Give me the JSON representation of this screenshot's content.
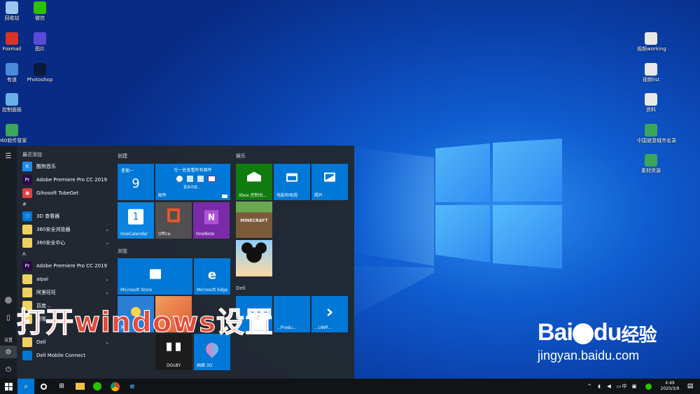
{
  "desktop": {
    "icons_left": [
      {
        "label": "回收站",
        "color": "#9cc7f0"
      },
      {
        "label": "微信",
        "color": "#2dc100"
      },
      {
        "label": "Foxmail",
        "color": "#d9332b"
      },
      {
        "label": "图片",
        "color": "#5a4bd6"
      },
      {
        "label": "有道",
        "color": "#4a8ad8"
      },
      {
        "label": "Photoshop",
        "color": "#0a1a3a"
      },
      {
        "label": "控制面板",
        "color": "#6ab0e8"
      },
      {
        "label": "360软件管家",
        "color": "#3aa65a"
      }
    ],
    "icons_right": [
      {
        "label": "视频working",
        "color": "#e8e8e8"
      },
      {
        "label": "视频list",
        "color": "#e8e8e8"
      },
      {
        "label": "资料",
        "color": "#e8e8e8"
      },
      {
        "label": "中国旅游城市名录",
        "color": "#3aa65a"
      },
      {
        "label": "素材资源",
        "color": "#3aa65a"
      }
    ]
  },
  "start_menu": {
    "rail": {
      "menu_icon": "hamburger-icon",
      "user_icon": "user-icon",
      "document_icon": "document-icon",
      "pictures_label": "设置",
      "settings_icon": "gear-icon",
      "power_icon": "power-icon"
    },
    "recent_header": "最近添加",
    "apps": [
      {
        "type": "app",
        "label": "酷狗音乐",
        "icon": "kugou-icon",
        "color": "#1a8cf0",
        "glyph": "K"
      },
      {
        "type": "app",
        "label": "Adobe Premiere Pro CC 2019",
        "icon": "premiere-icon",
        "color": "#2a0a4a",
        "glyph": "Pr"
      },
      {
        "type": "app",
        "label": "Gihosoft TubeGet",
        "icon": "tubeget-icon",
        "color": "#e04040",
        "glyph": "◉"
      },
      {
        "type": "letter",
        "label": "#"
      },
      {
        "type": "app",
        "label": "3D 查看器",
        "icon": "cube-icon",
        "color": "#0078d7",
        "glyph": "⬡"
      },
      {
        "type": "folder",
        "label": "360安全浏览器",
        "icon": "folder-icon",
        "color": "#f0d060",
        "glyph": ""
      },
      {
        "type": "folder",
        "label": "360安全中心",
        "icon": "folder-icon",
        "color": "#f0d060",
        "glyph": ""
      },
      {
        "type": "letter",
        "label": "A"
      },
      {
        "type": "app",
        "label": "Adobe Premiere Pro CC 2019",
        "icon": "premiere-icon",
        "color": "#2a0a4a",
        "glyph": "Pr"
      },
      {
        "type": "folder",
        "label": "aipai",
        "icon": "folder-icon",
        "color": "#f0d060",
        "glyph": ""
      },
      {
        "type": "folder",
        "label": "阿里旺旺",
        "icon": "folder-icon",
        "color": "#f0d060",
        "glyph": ""
      },
      {
        "type": "app",
        "label": "百度...",
        "icon": "baidu-icon",
        "color": "#f0d060",
        "glyph": ""
      },
      {
        "type": "app",
        "label": "便笺",
        "icon": "sticky-note-icon",
        "color": "#f0d060",
        "glyph": ""
      },
      {
        "type": "letter",
        "label": "D"
      },
      {
        "type": "folder",
        "label": "Dell",
        "icon": "folder-icon",
        "color": "#f0d060",
        "glyph": ""
      },
      {
        "type": "app",
        "label": "Dell Mobile Connect",
        "icon": "dell-icon",
        "color": "#0078d7",
        "glyph": ""
      }
    ],
    "groups": {
      "create": "创建",
      "browse": "浏览",
      "play": "娱乐",
      "dell": "Dell"
    },
    "tiles": {
      "calendar": {
        "weekday": "星期一",
        "day": "9"
      },
      "mail": {
        "title": "在一处查看所有邮件",
        "sub": "更多内容...",
        "label": "邮件"
      },
      "onecalendar": {
        "label": "OneCalendar",
        "glyph": "1"
      },
      "office": {
        "label": "Office"
      },
      "onenote": {
        "label": "OneNote",
        "glyph": "N"
      },
      "store": {
        "label": "Microsoft Store"
      },
      "edge": {
        "label": "Microsoft Edge",
        "glyph": "e"
      },
      "xbox": {
        "label": "Xbox 控制台..."
      },
      "movies": {
        "label": "电影和电视"
      },
      "photos": {
        "label": "照片"
      },
      "minecraft": {
        "label": "MINECRAFT"
      },
      "mickey": {
        "label": ""
      },
      "weather": {
        "label": "天..."
      },
      "paint": {
        "label": ""
      },
      "dolby": {
        "label": "DOLBY"
      },
      "paint3d": {
        "label": "画图 3D"
      },
      "dell1": {
        "label": ""
      },
      "dell2": {
        "label": "...Produ..."
      },
      "dell3": {
        "label": "...UWP..."
      }
    }
  },
  "overlay_text": "打开windows设置",
  "watermark": {
    "logo_text": "Bai",
    "logo_text2": "du",
    "logo_cn": "经验",
    "url": "jingyan.baidu.com"
  },
  "taskbar": {
    "time": "4:49",
    "date": "2020/3/9",
    "ime": "中",
    "colors": {
      "bg": "#101417",
      "accent": "#0078d7"
    }
  }
}
